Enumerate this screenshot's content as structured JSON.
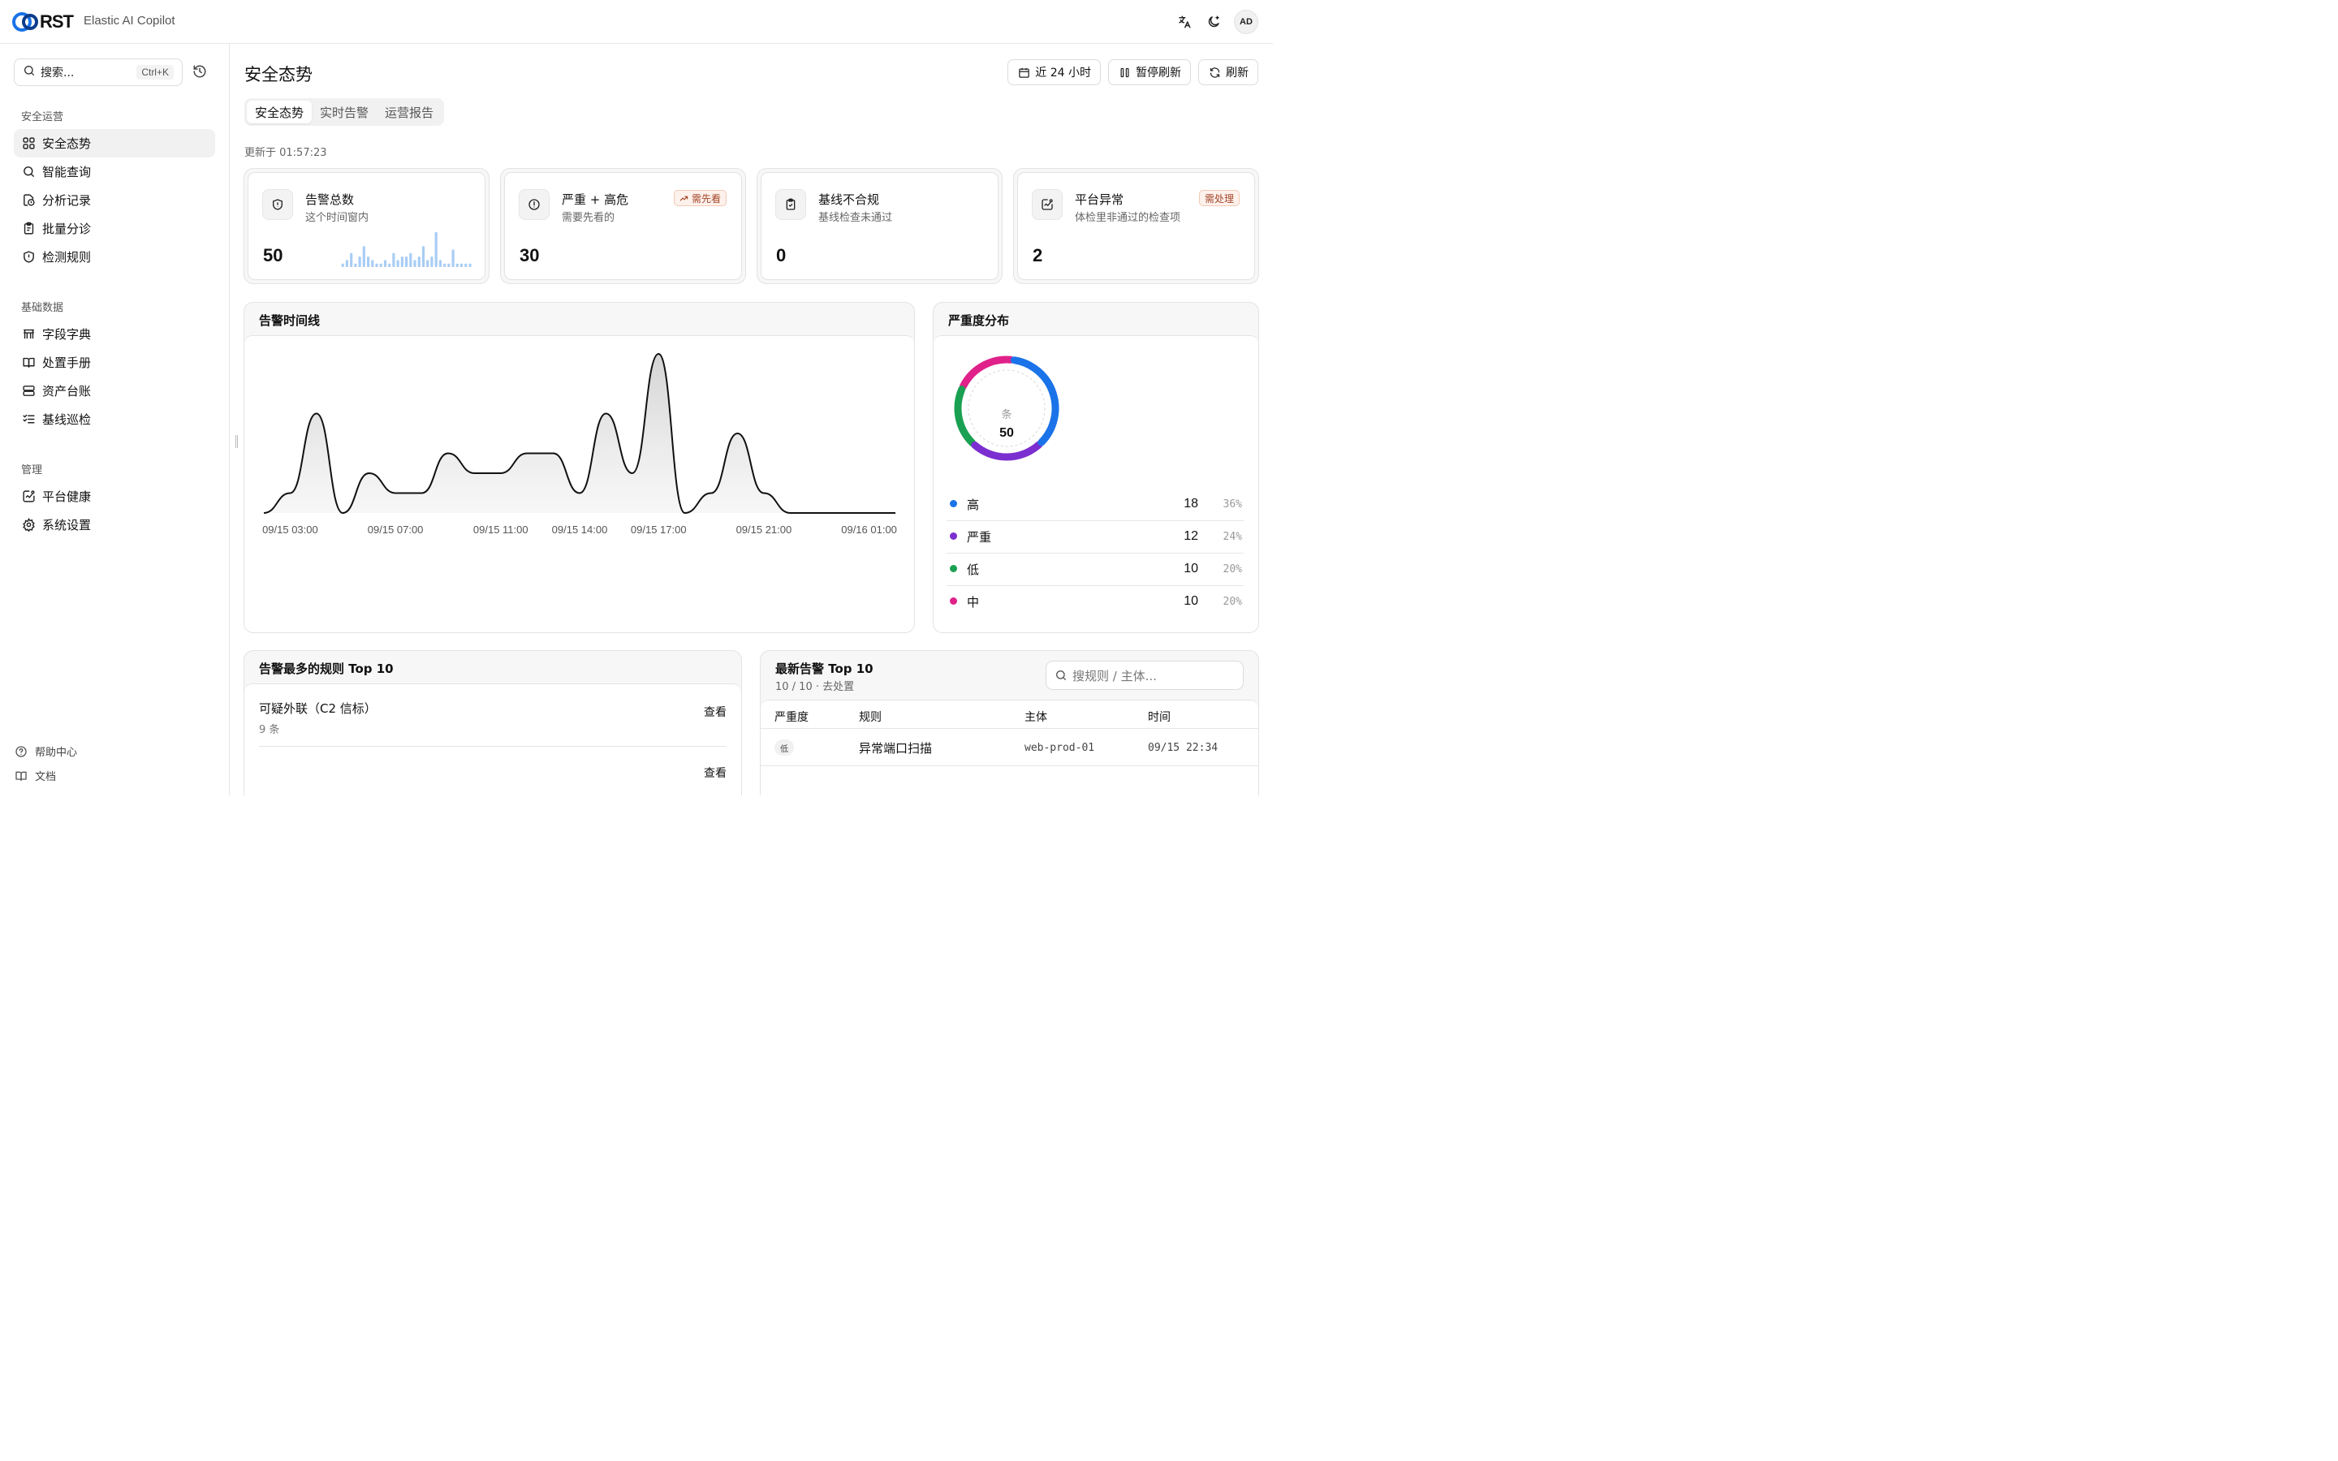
{
  "topbar": {
    "logo_text": "RST",
    "app_name": "Elastic AI Copilot",
    "avatar": "AD",
    "icons": [
      "translate-icon",
      "theme-toggle-icon"
    ]
  },
  "sidebar": {
    "search_placeholder": "搜索...",
    "search_shortcut": "Ctrl+K",
    "groups": [
      {
        "title": "安全运营",
        "items": [
          {
            "label": "安全态势",
            "icon": "dashboard-icon",
            "active": true
          },
          {
            "label": "智能查询",
            "icon": "search-icon"
          },
          {
            "label": "分析记录",
            "icon": "history-file-icon"
          },
          {
            "label": "批量分诊",
            "icon": "clipboard-list-icon"
          },
          {
            "label": "检测规则",
            "icon": "shield-alert-icon"
          }
        ]
      },
      {
        "title": "基础数据",
        "items": [
          {
            "label": "字段字典",
            "icon": "table-icon"
          },
          {
            "label": "处置手册",
            "icon": "book-icon"
          },
          {
            "label": "资产台账",
            "icon": "server-icon"
          },
          {
            "label": "基线巡检",
            "icon": "checklist-icon"
          }
        ]
      },
      {
        "title": "管理",
        "items": [
          {
            "label": "平台健康",
            "icon": "health-icon"
          },
          {
            "label": "系统设置",
            "icon": "gear-icon"
          }
        ]
      }
    ],
    "footer": [
      {
        "label": "帮助中心",
        "icon": "help-icon"
      },
      {
        "label": "文档",
        "icon": "docs-icon"
      }
    ]
  },
  "header": {
    "title": "安全态势",
    "range_label": "近 24 小时",
    "pause_label": "暂停刷新",
    "refresh_label": "刷新",
    "tabs": [
      "安全态势",
      "实时告警",
      "运营报告"
    ],
    "updated": "更新于 01:57:23"
  },
  "stats": [
    {
      "title": "告警总数",
      "sub": "这个时间窗内",
      "value": "50",
      "icon": "shield-icon",
      "badge": "",
      "spark": [
        1,
        2,
        4,
        1,
        3,
        6,
        3,
        2,
        1,
        1,
        2,
        1,
        4,
        2,
        3,
        3,
        4,
        2,
        3,
        6,
        2,
        3,
        10,
        2,
        1,
        1,
        5,
        1,
        1,
        1,
        1
      ]
    },
    {
      "title": "严重 + 高危",
      "sub": "需要先看的",
      "value": "30",
      "icon": "alert-circle-icon",
      "badge": "需先看"
    },
    {
      "title": "基线不合规",
      "sub": "基线检查未通过",
      "value": "0",
      "icon": "clipboard-check-icon",
      "badge": ""
    },
    {
      "title": "平台异常",
      "sub": "体检里非通过的检查项",
      "value": "2",
      "icon": "activity-icon",
      "badge": "需处理"
    }
  ],
  "timeline": {
    "title": "告警时间线",
    "ticks": [
      "09/15 03:00",
      "09/15 07:00",
      "09/15 11:00",
      "09/15 14:00",
      "09/15 17:00",
      "09/15 21:00",
      "09/16 01:00"
    ]
  },
  "severity": {
    "title": "严重度分布",
    "center_label": "条",
    "total": "50",
    "rows": [
      {
        "name": "高",
        "count": "18",
        "pct": "36%",
        "color": "#1a73e8"
      },
      {
        "name": "严重",
        "count": "12",
        "pct": "24%",
        "color": "#7b2fd0"
      },
      {
        "name": "低",
        "count": "10",
        "pct": "20%",
        "color": "#1aa052"
      },
      {
        "name": "中",
        "count": "10",
        "pct": "20%",
        "color": "#e0218a"
      }
    ]
  },
  "chart_data": {
    "type": "area",
    "title": "告警时间线",
    "x": [
      "09/15 02:00",
      "09/15 03:00",
      "09/15 04:00",
      "09/15 05:00",
      "09/15 06:00",
      "09/15 07:00",
      "09/15 08:00",
      "09/15 09:00",
      "09/15 10:00",
      "09/15 11:00",
      "09/15 12:00",
      "09/15 13:00",
      "09/15 14:00",
      "09/15 15:00",
      "09/15 16:00",
      "09/15 17:00",
      "09/15 18:00",
      "09/15 19:00",
      "09/15 20:00",
      "09/15 21:00",
      "09/15 22:00",
      "09/15 23:00",
      "09/16 00:00",
      "09/16 01:00",
      "09/16 02:00"
    ],
    "values": [
      0,
      1,
      5,
      0,
      2,
      1,
      1,
      3,
      2,
      2,
      3,
      3,
      1,
      5,
      2,
      8,
      0,
      1,
      4,
      1,
      0,
      0,
      0,
      0,
      0
    ],
    "ylim": [
      0,
      8
    ],
    "grid": false
  },
  "top_rules": {
    "title": "告警最多的规则 Top 10",
    "view_label": "查看",
    "items": [
      {
        "name": "可疑外联（C2 信标）",
        "count": "9 条"
      },
      {
        "name": "",
        "count": ""
      }
    ]
  },
  "latest_alerts": {
    "title": "最新告警 Top 10",
    "sub": "10 / 10 · 去处置",
    "filter_placeholder": "搜规则 / 主体...",
    "columns": [
      "严重度",
      "规则",
      "主体",
      "时间"
    ],
    "rows": [
      {
        "severity": "低",
        "rule": "异常端口扫描",
        "subject": "web-prod-01",
        "time": "09/15 22:34"
      }
    ]
  }
}
